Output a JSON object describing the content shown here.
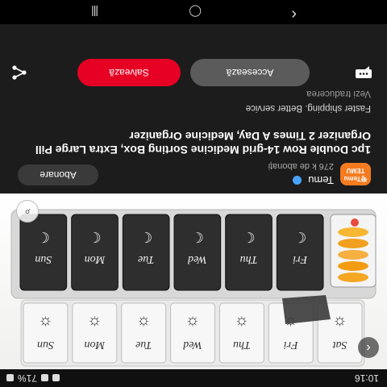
{
  "status_bar": {
    "time": "10:16",
    "battery": "71%"
  },
  "product_photo": {
    "top_labels": [
      "Sat",
      "Fri",
      "Thu",
      "Wed",
      "Tue",
      "Mon",
      "Sun"
    ],
    "bottom_labels": [
      "Fri",
      "Thu",
      "Wed",
      "Tue",
      "Mon",
      "Sun"
    ]
  },
  "seller": {
    "logo_line1": "夸Temu",
    "logo_line2": "TEMU",
    "name": "Temu",
    "subscribers": "276 k de abonați"
  },
  "subscribe_label": "Abonare",
  "title": "1pc Double Row 14-grid Medicine Sorting Box, Extra Large Pill Organizer 2 Times A Day, Medicine Organizer",
  "subtitle": "Faster shipping. Better service",
  "translate_label": "Vezi traducerea",
  "visit_label": "Accesează",
  "save_label": "Salvează",
  "nav": {
    "back": "‹",
    "home": "◯",
    "recents": "|||"
  }
}
